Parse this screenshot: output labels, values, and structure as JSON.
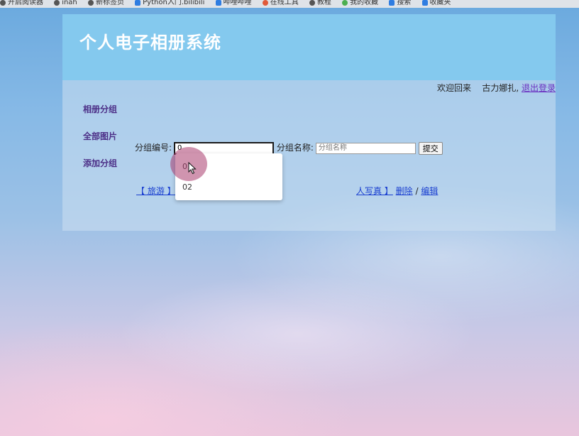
{
  "browser": {
    "bookmarks": [
      "开启阅读器",
      "inah",
      "新标签页",
      "Python入门.bilibili",
      "哔哩哔哩",
      "在线工具",
      "教程",
      "我的收藏",
      "搜索",
      "收藏夹"
    ]
  },
  "app": {
    "title": "个人电子相册系统"
  },
  "welcome": {
    "greeting": "欢迎回来",
    "username": "古力娜扎,",
    "logout": "退出登录"
  },
  "sidebar": {
    "items": [
      {
        "label": "相册分组"
      },
      {
        "label": "全部图片"
      },
      {
        "label": "添加分组"
      }
    ]
  },
  "form": {
    "group_id_label": "分组编号:",
    "group_id_value": "0",
    "group_name_label": "分组名称:",
    "group_name_placeholder": "分组名称",
    "submit_label": "提交"
  },
  "autocomplete": {
    "options": [
      "01",
      "02"
    ]
  },
  "groups": {
    "first": "【 旅游 】",
    "second": "人写真 】",
    "delete_label": "删除",
    "separator": "/",
    "edit_label": "编辑"
  },
  "colors": {
    "header_bg": "#84c9ee",
    "nav_link": "#4b2d86",
    "link_blue": "#1a3fd0",
    "logout_link": "#6a2fc0"
  }
}
